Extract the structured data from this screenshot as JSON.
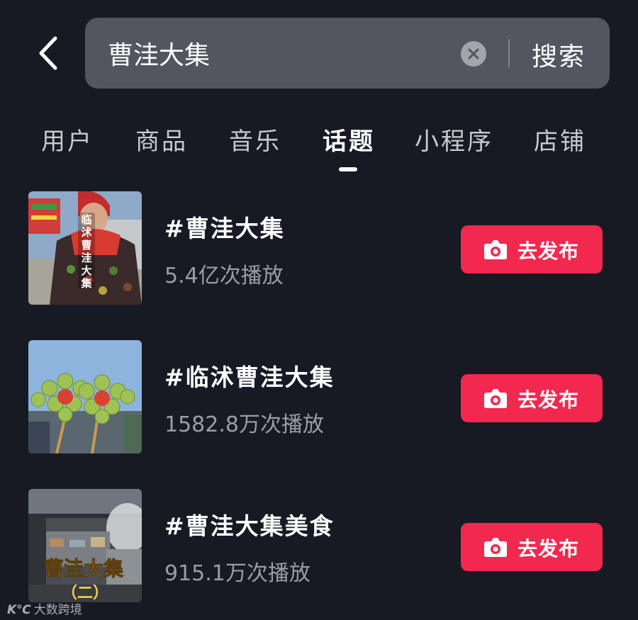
{
  "search": {
    "query": "曹洼大集",
    "button_label": "搜索",
    "icons": {
      "back": "chevron-left-icon",
      "clear": "clear-circle-icon"
    }
  },
  "tabs": [
    {
      "label": "用户",
      "active": false
    },
    {
      "label": "商品",
      "active": false
    },
    {
      "label": "音乐",
      "active": false
    },
    {
      "label": "话题",
      "active": true
    },
    {
      "label": "小程序",
      "active": false
    },
    {
      "label": "店铺",
      "active": false
    }
  ],
  "topics": [
    {
      "title": "#曹洼大集",
      "plays": "5.4亿次播放",
      "button_label": "去发布",
      "thumb_overlay": [
        "临",
        "沭",
        "曹",
        "洼",
        "大",
        "集"
      ]
    },
    {
      "title": "#临沭曹洼大集",
      "plays": "1582.8万次播放",
      "button_label": "去发布"
    },
    {
      "title": "#曹洼大集美食",
      "plays": "915.1万次播放",
      "button_label": "去发布",
      "thumb_caption": "曹洼大集",
      "thumb_subcaption": "（二）"
    }
  ],
  "watermark": {
    "logo": "K℃",
    "text": "大数跨境"
  },
  "colors": {
    "background": "#171923",
    "search_bg": "#53565f",
    "accent": "#f2284f",
    "secondary_text": "#9b9da4"
  }
}
